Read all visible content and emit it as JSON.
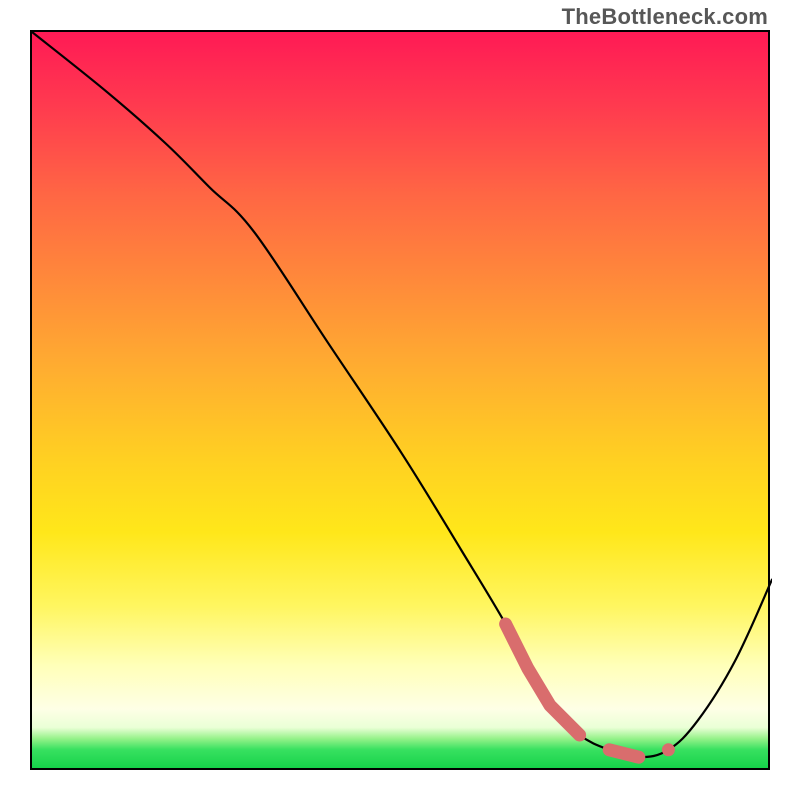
{
  "watermark": "TheBottleneck.com",
  "chart_data": {
    "type": "line",
    "title": "",
    "xlabel": "",
    "ylabel": "",
    "xlim": [
      0,
      100
    ],
    "ylim": [
      0,
      100
    ],
    "grid": false,
    "legend": false,
    "series": [
      {
        "name": "curve",
        "x": [
          0,
          10,
          18,
          24,
          30,
          40,
          50,
          58,
          64,
          67,
          70,
          74,
          78,
          82,
          86,
          90,
          95,
          100
        ],
        "y": [
          100,
          92,
          85,
          79,
          73,
          58,
          43,
          30,
          20,
          14,
          9,
          5,
          3,
          2,
          3,
          7,
          15,
          26
        ]
      }
    ],
    "accent_points": {
      "name": "highlight",
      "x": [
        64,
        67,
        70,
        74,
        78,
        82,
        86
      ],
      "y": [
        20,
        14,
        9,
        5,
        3,
        2,
        3
      ],
      "style": "thick-dashed",
      "color": "#d96d6d"
    },
    "background_gradient": {
      "top": "#ff1a55",
      "mid": "#ffe71a",
      "bottom": "#16d24a"
    }
  }
}
